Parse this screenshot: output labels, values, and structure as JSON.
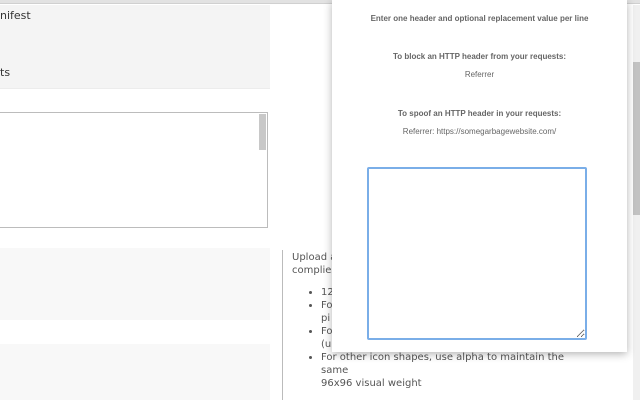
{
  "background": {
    "box_line1": "nifest",
    "box_line2": "ts",
    "help_intro_line1": "Upload a",
    "help_intro_line2": "complies",
    "bullets": [
      "12",
      "Fo",
      "pi",
      "Fo",
      "(u",
      "For other icon shapes, use alpha to maintain the same",
      "96x96 visual weight"
    ]
  },
  "popup": {
    "instruction": "Enter one header and optional replacement value per line",
    "block_heading": "To block an HTTP header from your requests:",
    "block_example": "Referrer",
    "spoof_heading": "To spoof an HTTP header in your requests:",
    "spoof_example": "Referrer: https://somegarbagewebsite.com/",
    "headers_value": ""
  }
}
